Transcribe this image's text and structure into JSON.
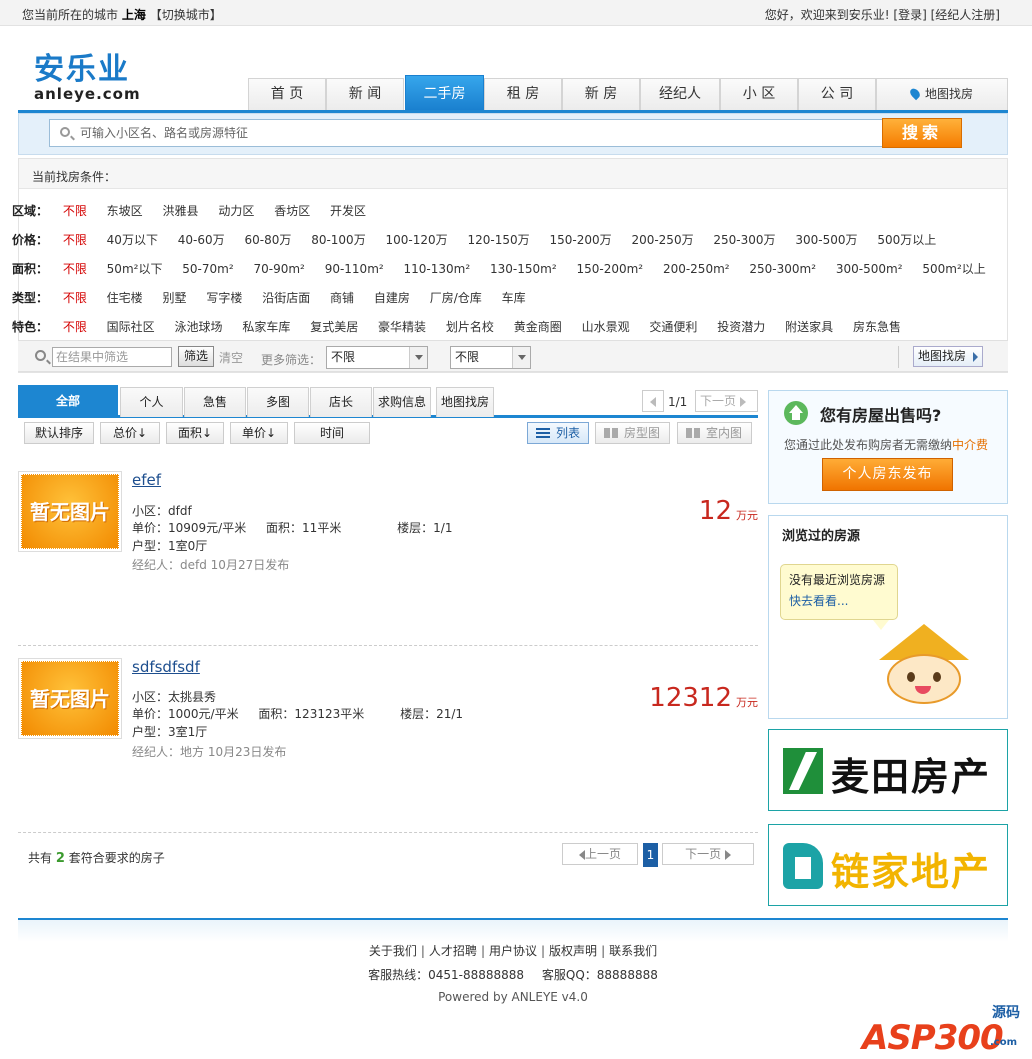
{
  "topbar": {
    "city_prefix": "您当前所在的城市",
    "city": "上海",
    "switch_city": "【切换城市】",
    "welcome": "您好，欢迎来到安乐业!",
    "login": "[登录]",
    "agent_register": "[经纪人注册]"
  },
  "logo": {
    "cn": "安乐业",
    "en": "anleye.com"
  },
  "nav": {
    "items": [
      "首 页",
      "新 闻",
      "二手房",
      "租 房",
      "新 房",
      "经纪人",
      "小 区",
      "公 司"
    ],
    "active_index": 2,
    "map_search": "地图找房"
  },
  "search": {
    "placeholder": "可输入小区名、路名或房源特征",
    "button": "搜索"
  },
  "filters": {
    "current_label": "当前找房条件：",
    "rows": [
      {
        "label": "区域：",
        "options": [
          "不限",
          "东坡区",
          "洪雅县",
          "动力区",
          "香坊区",
          "开发区"
        ]
      },
      {
        "label": "价格：",
        "options": [
          "不限",
          "40万以下",
          "40-60万",
          "60-80万",
          "80-100万",
          "100-120万",
          "120-150万",
          "150-200万",
          "200-250万",
          "250-300万",
          "300-500万",
          "500万以上"
        ]
      },
      {
        "label": "面积：",
        "options": [
          "不限",
          "50m²以下",
          "50-70m²",
          "70-90m²",
          "90-110m²",
          "110-130m²",
          "130-150m²",
          "150-200m²",
          "200-250m²",
          "250-300m²",
          "300-500m²",
          "500m²以上"
        ]
      },
      {
        "label": "类型：",
        "options": [
          "不限",
          "住宅楼",
          "别墅",
          "写字楼",
          "沿街店面",
          "商铺",
          "自建房",
          "厂房/仓库",
          "车库"
        ]
      },
      {
        "label": "特色：",
        "options": [
          "不限",
          "国际社区",
          "泳池球场",
          "私家车库",
          "复式美居",
          "豪华精装",
          "划片名校",
          "黄金商圈",
          "山水景观",
          "交通便利",
          "投资潜力",
          "附送家具",
          "房东急售"
        ]
      }
    ]
  },
  "subfilter": {
    "keyword_placeholder": "在结果中筛选",
    "filter_button": "筛选",
    "clear": "清空",
    "more": "更多筛选：",
    "select1": "不限",
    "select2": "不限",
    "map_button": "地图找房"
  },
  "list_tabs": [
    "全部",
    "个人",
    "急售",
    "多图",
    "店长",
    "求购信息",
    "地图找房"
  ],
  "pager_top": {
    "page": "1/1",
    "next": "下一页"
  },
  "sort": {
    "buttons": [
      "默认排序",
      "总价↓",
      "面积↓",
      "单价↓",
      "时间"
    ],
    "views": [
      "列表",
      "房型图",
      "室内图"
    ]
  },
  "listings": [
    {
      "thumb_text": "暂无图片",
      "title": "efef",
      "community": "小区：dfdf",
      "unit_price": "单价：10909元/平米",
      "area": "面积：11平米",
      "floor": "楼层：1/1",
      "layout": "户型：1室0厅",
      "agent": "经纪人：defd",
      "date": "10月27日发布",
      "price": "12",
      "price_unit": "万元"
    },
    {
      "thumb_text": "暂无图片",
      "title": "sdfsdfsdf",
      "community": "小区：太挑县秀",
      "unit_price": "单价：1000元/平米",
      "area": "面积：123123平米",
      "floor": "楼层：21/1",
      "layout": "户型：3室1厅",
      "agent": "经纪人：地方",
      "date": "10月23日发布",
      "price": "12312",
      "price_unit": "万元"
    }
  ],
  "summary": {
    "prefix": "共有",
    "count": "2",
    "suffix": "套符合要求的房子"
  },
  "pager_bottom": {
    "prev": "上一页",
    "current": "1",
    "next": "下一页"
  },
  "sidebar": {
    "sell": {
      "title": "您有房屋出售吗?",
      "desc_prefix": "您通过此处发布购房者无需缴纳",
      "desc_highlight": "中介费",
      "button": "个人房东发布"
    },
    "viewed": {
      "title": "浏览过的房源",
      "empty": "没有最近浏览房源",
      "link": "快去看看..."
    },
    "ads": [
      "麦田房产",
      "链家地产"
    ]
  },
  "footer": {
    "links": [
      "关于我们",
      "人才招聘",
      "用户协议",
      "版权声明",
      "联系我们"
    ],
    "hotline": "客服热线：0451-88888888",
    "qq": "客服QQ：88888888",
    "powered": "Powered by ANLEYE v4.0"
  },
  "watermark": {
    "brand": "ASP300",
    "side": "源码",
    "url": ".com"
  }
}
